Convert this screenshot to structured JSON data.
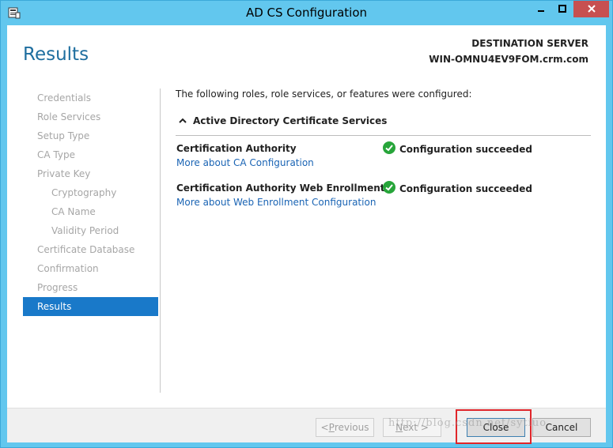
{
  "window": {
    "title": "AD CS Configuration",
    "colors": {
      "titlebar": "#62c7ee",
      "accent": "#1979c9",
      "close_highlight": "#e0262b",
      "success": "#27a53a"
    }
  },
  "header": {
    "page_title": "Results",
    "destination_label": "DESTINATION SERVER",
    "destination_server": "WIN-OMNU4EV9FOM.crm.com"
  },
  "nav": {
    "items": [
      {
        "label": "Credentials",
        "sub": false,
        "active": false
      },
      {
        "label": "Role Services",
        "sub": false,
        "active": false
      },
      {
        "label": "Setup Type",
        "sub": false,
        "active": false
      },
      {
        "label": "CA Type",
        "sub": false,
        "active": false
      },
      {
        "label": "Private Key",
        "sub": false,
        "active": false
      },
      {
        "label": "Cryptography",
        "sub": true,
        "active": false
      },
      {
        "label": "CA Name",
        "sub": true,
        "active": false
      },
      {
        "label": "Validity Period",
        "sub": true,
        "active": false
      },
      {
        "label": "Certificate Database",
        "sub": false,
        "active": false
      },
      {
        "label": "Confirmation",
        "sub": false,
        "active": false
      },
      {
        "label": "Progress",
        "sub": false,
        "active": false
      },
      {
        "label": "Results",
        "sub": false,
        "active": true
      }
    ]
  },
  "main": {
    "intro": "The following roles, role services, or features were configured:",
    "section_title": "Active Directory Certificate Services",
    "results": [
      {
        "name": "Certification Authority",
        "link": "More about CA Configuration",
        "status": "Configuration succeeded"
      },
      {
        "name": "Certification Authority Web Enrollment",
        "link": "More about Web Enrollment Configuration",
        "status": "Configuration succeeded"
      }
    ]
  },
  "footer": {
    "previous_prefix": "< ",
    "previous_mnemonic": "P",
    "previous_rest": "revious",
    "next_mnemonic": "N",
    "next_rest": "ext >",
    "close_label": "Close",
    "cancel_label": "Cancel"
  },
  "watermark": "http://blog.csdn.net/sytiuo"
}
